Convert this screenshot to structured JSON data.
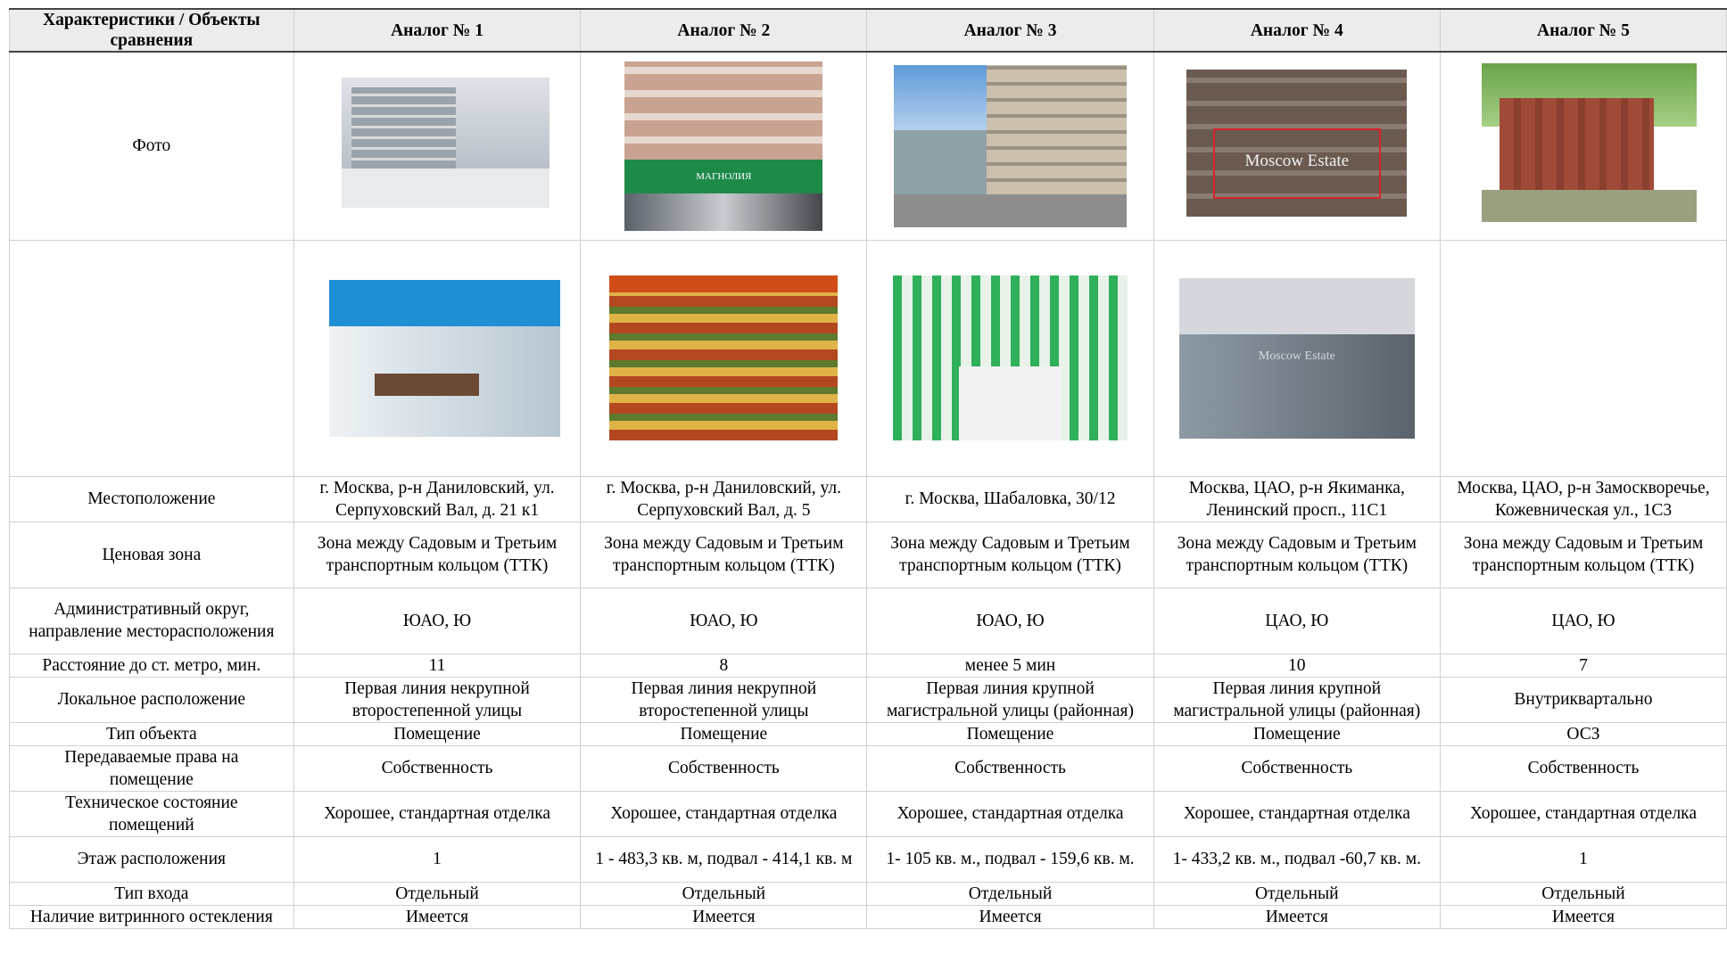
{
  "headers": [
    "Характеристики / Объекты сравнения",
    "Аналог № 1",
    "Аналог № 2",
    "Аналог № 3",
    "Аналог № 4",
    "Аналог № 5"
  ],
  "photo_row_label": "Фото",
  "photos_exterior": [
    {
      "name": "facade-photo-1",
      "wm": ""
    },
    {
      "name": "facade-photo-2",
      "wm": "МАГНОЛИЯ"
    },
    {
      "name": "facade-photo-3",
      "wm": ""
    },
    {
      "name": "facade-photo-4",
      "wm": "Moscow Estate"
    },
    {
      "name": "facade-photo-5",
      "wm": ""
    }
  ],
  "photos_interior": [
    {
      "name": "interior-photo-1",
      "wm": ""
    },
    {
      "name": "interior-photo-2",
      "wm": ""
    },
    {
      "name": "interior-photo-3",
      "wm": ""
    },
    {
      "name": "interior-photo-4",
      "wm": "Moscow Estate"
    }
  ],
  "rows": [
    {
      "label": "Местоположение",
      "cells": [
        "г. Москва, р-н Даниловский, ул. Серпуховский Вал, д. 21 к1",
        "г. Москва, р-н Даниловский, ул. Серпуховский Вал, д. 5",
        "г. Москва, Шабаловка, 30/12",
        "Москва, ЦАО, р-н Якиманка, Ленинский просп., 11С1",
        "Москва, ЦАО, р-н Замоскворечье, Кожевническая ул., 1С3"
      ]
    },
    {
      "label": "Ценовая зона",
      "cells": [
        "Зона между Садовым и Третьим транспортным кольцом (ТТК)",
        "Зона между Садовым и Третьим транспортным кольцом (ТТК)",
        "Зона между Садовым и Третьим транспортным кольцом (ТТК)",
        "Зона между Садовым и Третьим транспортным кольцом (ТТК)",
        "Зона между Садовым и Третьим транспортным кольцом (ТТК)"
      ]
    },
    {
      "label": "Административный округ, направление месторасположения",
      "cells": [
        "ЮАО, Ю",
        "ЮАО, Ю",
        "ЮАО, Ю",
        "ЦАО, Ю",
        "ЦАО, Ю"
      ]
    },
    {
      "label": "Расстояние до ст. метро, мин.",
      "cells": [
        "11",
        "8",
        "менее 5 мин",
        "10",
        "7"
      ]
    },
    {
      "label": "Локальное расположение",
      "cells": [
        "Первая линия некрупной второстепенной улицы",
        "Первая линия некрупной второстепенной улицы",
        "Первая линия крупной магистральной улицы (районная)",
        "Первая линия крупной магистральной улицы (районная)",
        "Внутриквартально"
      ]
    },
    {
      "label": "Тип объекта",
      "cells": [
        "Помещение",
        "Помещение",
        "Помещение",
        "Помещение",
        "ОСЗ"
      ]
    },
    {
      "label": "Передаваемые права на помещение",
      "cells": [
        "Собственность",
        "Собственность",
        "Собственность",
        "Собственность",
        "Собственность"
      ]
    },
    {
      "label": "Техническое состояние помещений",
      "cells": [
        "Хорошее, стандартная отделка",
        "Хорошее, стандартная отделка",
        "Хорошее, стандартная отделка",
        "Хорошее, стандартная отделка",
        "Хорошее, стандартная отделка"
      ]
    },
    {
      "label": "Этаж расположения",
      "cells": [
        "1",
        "1 - 483,3 кв. м, подвал - 414,1 кв. м",
        "1- 105 кв. м., подвал - 159,6 кв. м.",
        "1- 433,2 кв. м., подвал -60,7 кв. м.",
        "1"
      ]
    },
    {
      "label": "Тип входа",
      "cells": [
        "Отдельный",
        "Отдельный",
        "Отдельный",
        "Отдельный",
        "Отдельный"
      ]
    },
    {
      "label": "Наличие витринного остекления",
      "cells": [
        "Имеется",
        "Имеется",
        "Имеется",
        "Имеется",
        "Имеется"
      ]
    }
  ]
}
